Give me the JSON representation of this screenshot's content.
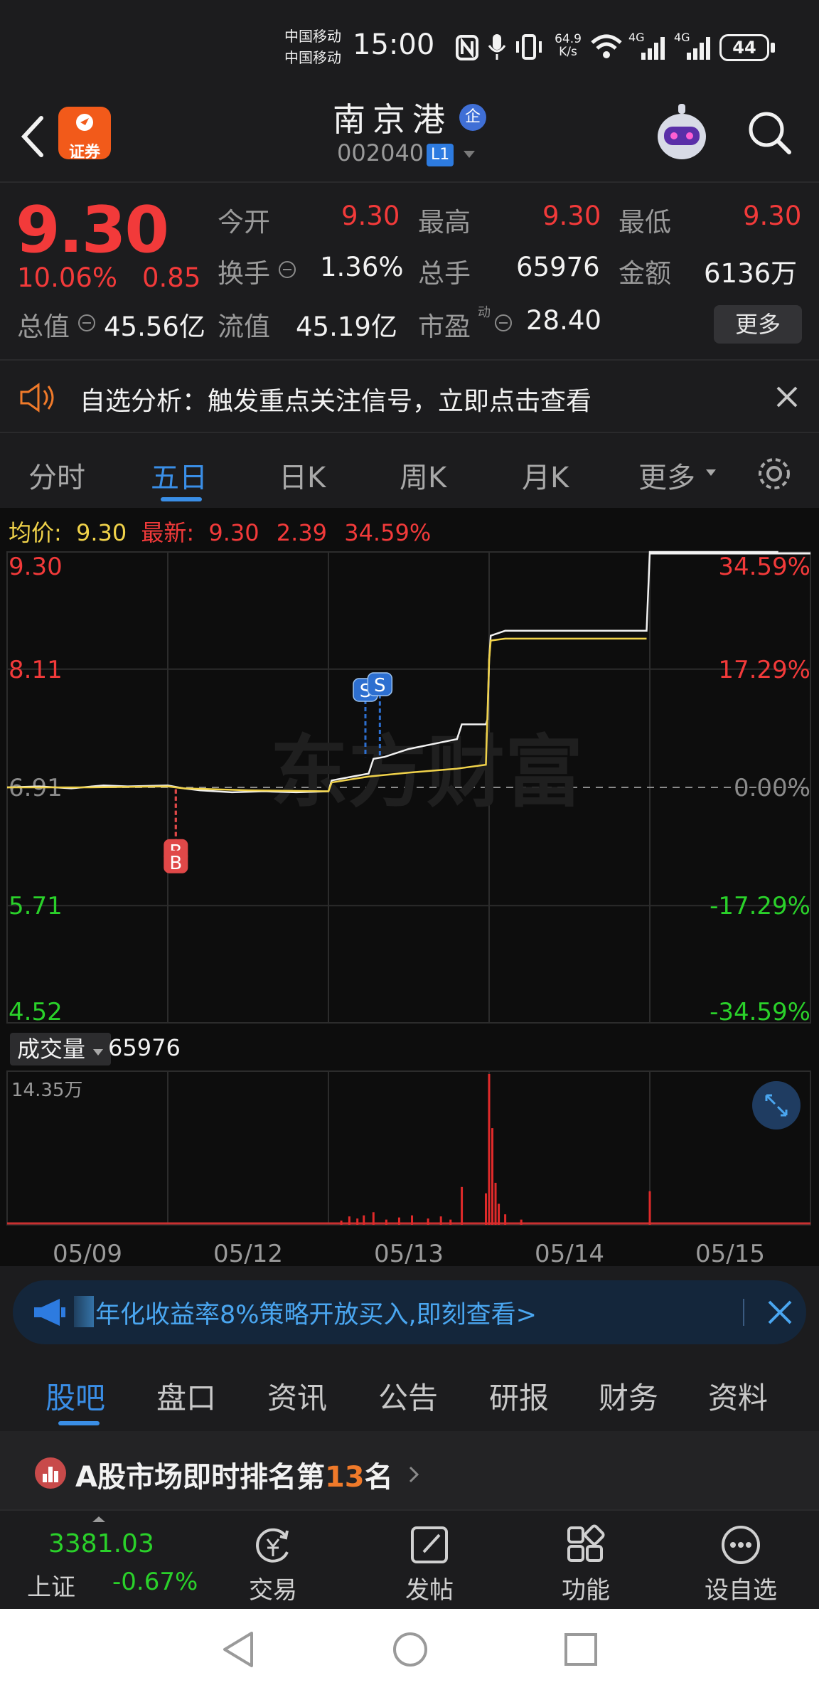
{
  "status_bar": {
    "carrier1": "中国移动",
    "carrier2": "中国移动",
    "time": "15:00",
    "net_speed_value": "64.9",
    "net_speed_unit": "K/s",
    "signal1_label": "4G",
    "signal2_label": "4G",
    "battery": "44"
  },
  "header": {
    "logo_text": "证券",
    "stock_name": "南京港",
    "enterprise_badge": "企",
    "stock_code": "002040",
    "level_badge": "L1"
  },
  "quote": {
    "price": "9.30",
    "change_pct": "10.06%",
    "change_amt": "0.85",
    "open_label": "今开",
    "open": "9.30",
    "high_label": "最高",
    "high": "9.30",
    "low_label": "最低",
    "low": "9.30",
    "turnover_label": "换手",
    "turnover": "1.36%",
    "volume_label": "总手",
    "volume": "65976",
    "amount_label": "金额",
    "amount": "6136万",
    "mktcap_label": "总值",
    "mktcap": "45.56亿",
    "float_label": "流值",
    "float_cap": "45.19亿",
    "pe_label": "市盈",
    "pe_sup": "动",
    "pe": "28.40",
    "more_label": "更多"
  },
  "alert": {
    "text": "自选分析：触发重点关注信号，立即点击查看"
  },
  "tabs": [
    {
      "label": "分时"
    },
    {
      "label": "五日"
    },
    {
      "label": "日K"
    },
    {
      "label": "周K"
    },
    {
      "label": "月K"
    },
    {
      "label": "更多"
    }
  ],
  "chart_info": {
    "avg_label": "均价:",
    "avg_value": "9.30",
    "latest_label": "最新:",
    "latest_value": "9.30",
    "chg_value": "2.39",
    "chg_pct": "34.59%"
  },
  "volume_panel": {
    "label": "成交量",
    "value": "65976",
    "max_label": "14.35万"
  },
  "chart_data": {
    "type": "line",
    "title": "",
    "y_left_ticks": [
      "9.30",
      "8.11",
      "6.91",
      "5.71",
      "4.52"
    ],
    "y_right_ticks": [
      "34.59%",
      "17.29%",
      "0.00%",
      "-17.29%",
      "-34.59%"
    ],
    "x_ticks": [
      "05/09",
      "05/12",
      "05/13",
      "05/14",
      "05/15"
    ],
    "ylim": [
      4.52,
      9.3
    ],
    "prev_close": 6.91,
    "watermark": "东方财富",
    "series": [
      {
        "name": "price",
        "color": "#f2f2f2",
        "x": [
          0,
          20,
          40,
          60,
          75,
          100,
          110,
          120,
          140,
          160,
          180,
          200,
          202,
          215,
          225,
          228,
          235,
          250,
          265,
          280,
          283,
          298,
          299,
          300,
          301,
          310,
          330,
          350,
          370,
          398,
          400,
          410,
          430,
          450,
          480
        ],
        "y": [
          6.91,
          6.92,
          6.9,
          6.93,
          6.92,
          6.93,
          6.9,
          6.88,
          6.86,
          6.87,
          6.86,
          6.87,
          6.98,
          7.02,
          7.05,
          7.2,
          7.22,
          7.3,
          7.35,
          7.4,
          7.55,
          7.55,
          7.6,
          8.21,
          8.45,
          8.5,
          8.5,
          8.5,
          8.5,
          8.5,
          9.3,
          9.3,
          9.3,
          9.3,
          9.3
        ]
      },
      {
        "name": "avg",
        "color": "#f0d24a",
        "x": [
          0,
          50,
          100,
          110,
          150,
          200,
          202,
          225,
          250,
          280,
          298,
          300,
          301,
          310,
          398
        ],
        "y": [
          6.91,
          6.91,
          6.92,
          6.9,
          6.88,
          6.87,
          6.96,
          7.02,
          7.06,
          7.1,
          7.14,
          8.2,
          8.4,
          8.42,
          8.42
        ]
      }
    ],
    "markers": [
      {
        "label": "B",
        "x": 105,
        "type": "buy",
        "color": "#e04848"
      },
      {
        "label": "B",
        "x": 105,
        "type": "buy",
        "color": "#e04848"
      },
      {
        "label": "S",
        "x": 223,
        "type": "sell",
        "color": "#2d6fd0"
      },
      {
        "label": "S",
        "x": 232,
        "type": "sell",
        "color": "#2d6fd0"
      }
    ],
    "volume": {
      "ymax": 143500,
      "bars": [
        {
          "x": 208,
          "v": 4000
        },
        {
          "x": 213,
          "v": 8000
        },
        {
          "x": 218,
          "v": 6000
        },
        {
          "x": 222,
          "v": 9000
        },
        {
          "x": 228,
          "v": 12000
        },
        {
          "x": 236,
          "v": 5000
        },
        {
          "x": 244,
          "v": 7000
        },
        {
          "x": 252,
          "v": 9000
        },
        {
          "x": 262,
          "v": 6000
        },
        {
          "x": 270,
          "v": 8000
        },
        {
          "x": 276,
          "v": 5000
        },
        {
          "x": 283,
          "v": 36000
        },
        {
          "x": 298,
          "v": 30000
        },
        {
          "x": 300,
          "v": 143500
        },
        {
          "x": 302,
          "v": 92000
        },
        {
          "x": 304,
          "v": 40000
        },
        {
          "x": 306,
          "v": 20000
        },
        {
          "x": 310,
          "v": 10000
        },
        {
          "x": 320,
          "v": 5000
        },
        {
          "x": 400,
          "v": 32000
        }
      ]
    }
  },
  "ad": {
    "text": "年化收益率8%策略开放买入,即刻查看>"
  },
  "bottom_tabs": [
    {
      "label": "股吧"
    },
    {
      "label": "盘口"
    },
    {
      "label": "资讯"
    },
    {
      "label": "公告"
    },
    {
      "label": "研报"
    },
    {
      "label": "财务"
    },
    {
      "label": "资料"
    }
  ],
  "rank": {
    "prefix": "A股市场即时排名第",
    "num": "13",
    "suffix": "名"
  },
  "nav": {
    "index_value": "3381.03",
    "index_name": "上证",
    "index_chg": "-0.67%",
    "trade": "交易",
    "post": "发帖",
    "func": "功能",
    "watch": "设自选"
  }
}
